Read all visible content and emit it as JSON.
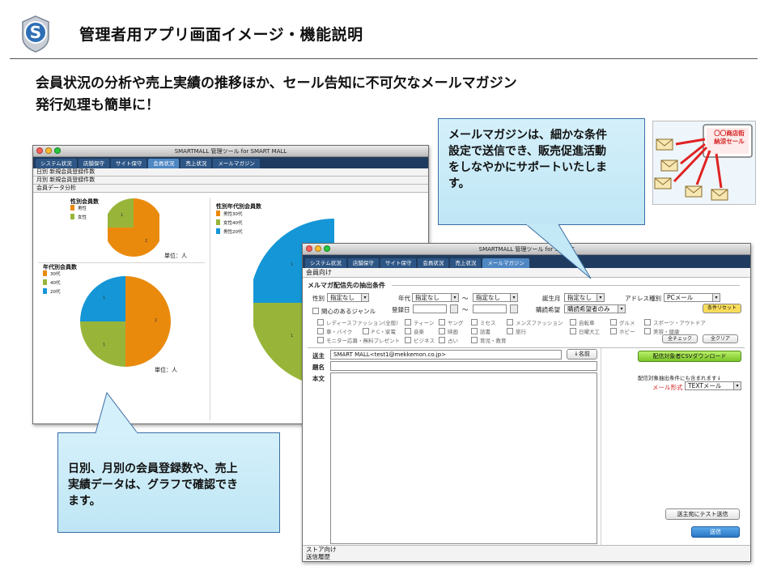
{
  "slide": {
    "title": "管理者用アプリ画面イメージ・機能説明",
    "lead_line1": "会員状況の分析や売上実績の推移ほか、セール告知に不可欠なメールマガジン",
    "lead_line2": "発行処理も簡単に！"
  },
  "callout_mail": {
    "line1": "メールマガジンは、細かな条件",
    "line2": "設定で送信でき、販売促進活動",
    "line3": "をしなやかにサポートいたしま",
    "line4": "す。"
  },
  "callout_member": {
    "line1": "日別、月別の会員登録数や、売上",
    "line2": "実績データは、グラフで確認でき",
    "line3": "ます。"
  },
  "illustration": {
    "badge_line1": "〇〇商店街",
    "badge_line2": "納涼セール"
  },
  "window_back": {
    "title": "SMARTMALL 管理ツール for SMART MALL",
    "tabs": [
      "システム状況",
      "店舗保守",
      "サイト保守",
      "会員状況",
      "売上状況",
      "メールマガジン"
    ],
    "rows": [
      "日別 新規会員登録件数",
      "月別 新規会員登録件数",
      "会員データ分析"
    ],
    "chart_gender_title": "性別会員数",
    "chart_gender_legend": [
      "男性",
      "女性"
    ],
    "chart_gender_labels": [
      "1",
      "2"
    ],
    "chart_age_title": "年代別会員数",
    "chart_age_legend": [
      "30代",
      "40代",
      "20代"
    ],
    "chart_age_labels": [
      "1",
      "1",
      "2"
    ],
    "chart_sexage_title": "性別年代別会員数",
    "chart_sexage_legend": [
      "男性30代",
      "女性40代",
      "男性20代"
    ],
    "chart_sexage_labels": [
      "1",
      "1"
    ],
    "unit_label": "単位：人"
  },
  "window_front": {
    "title": "SMARTMALL 管理ツール for SMART",
    "tabs": [
      "システム状況",
      "店舗保守",
      "サイト保守",
      "会員状況",
      "売上状況",
      "メールマガジン"
    ],
    "section_member": "会員向け",
    "section_extract": "メルマガ配信先の抽出条件",
    "gender_label": "性別",
    "gender_value": "指定なし",
    "age_label": "年代",
    "age_from": "指定なし",
    "age_to": "指定なし",
    "tilde": "～",
    "birth_label": "誕生月",
    "birth_value": "指定なし",
    "address_label": "アドレス種別",
    "address_value": "PCメール",
    "genre_label": "関心のあるジャンル",
    "regdate_label": "登録日",
    "subscribe_label": "購読希望",
    "subscribe_value": "購読希望者のみ",
    "reset_button": "条件リセット",
    "genres": [
      "レディースファッション(全般)",
      "ティーン",
      "ヤング",
      "ミセス",
      "メンズファッション",
      "自転車",
      "グルメ",
      "スポーツ・アウトドア",
      "車・バイク",
      "P C・家電",
      "音楽",
      "映画",
      "読書",
      "旅行",
      "日曜大工",
      "ホビー",
      "美容・健康",
      "モニター応募・無料プレゼント",
      "ビジネス",
      "占い",
      "育児・教育"
    ],
    "check_all": "全チェック",
    "clear_all": "全クリア",
    "from_label": "送主",
    "from_value": "SMART MALL<test1@mekkemon.co.jp>",
    "name_button": "↓名前",
    "subject_label": "題名",
    "body_label": "本文",
    "csv_button": "配信対象者CSVダウンロード",
    "note": "配信対象抽出条件にも含まれます↓",
    "format_label": "メール形式",
    "format_value": "TEXTメール",
    "test_button": "送主宛にテスト送信",
    "send_button": "送信",
    "footer_store": "ストア向け",
    "footer_history": "送信履歴"
  },
  "colors": {
    "orange": "#ea8a0d",
    "green": "#98b53a",
    "blue": "#1596d6",
    "tab_bar": "#1f3c60",
    "callout_border": "#3b6ea5"
  }
}
